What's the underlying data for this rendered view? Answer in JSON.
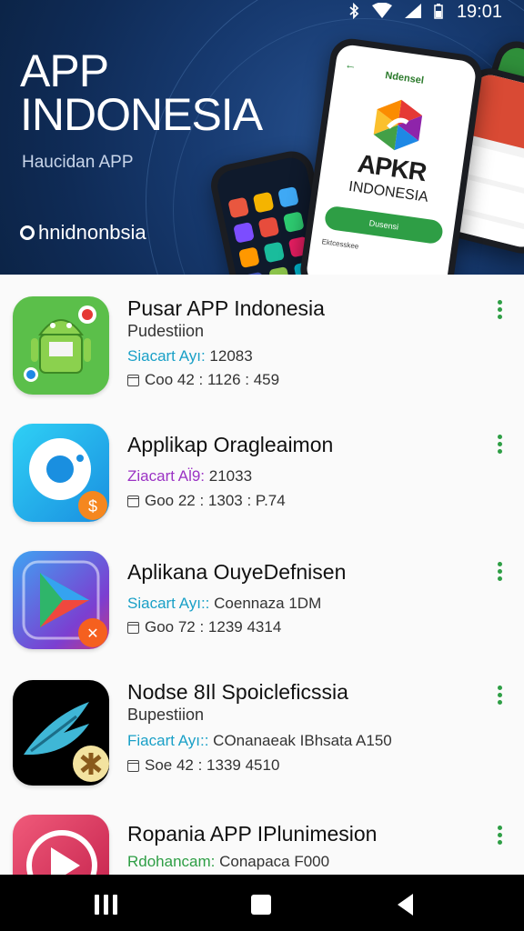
{
  "status_bar": {
    "time": "19:01"
  },
  "banner": {
    "title_line1": "APP",
    "title_line2": "INDONESIA",
    "subtitle": "Haucidan APP",
    "brand": "hnidnonbsia",
    "mockup": {
      "header": "Ndensel",
      "word": "APKR",
      "word2": "INDONESIA",
      "button": "Dusensi",
      "footer": "Ektcesskee"
    }
  },
  "apps": [
    {
      "title": "Pusar APP Indonesia",
      "subtitle": "Pudestiion",
      "meta1_key": "Siacart Ayı:",
      "meta1_val": " 12083",
      "meta2": "Coo 42 : 1126 : 459"
    },
    {
      "title": "Applikap Oraglеаimon",
      "subtitle": "",
      "meta1_key": "Ziacart Al̈9:",
      "meta1_val": " 21033",
      "meta2": "Goo 22 : 1303 : P.74"
    },
    {
      "title": "Aplikana OuyeDefnisen",
      "subtitle": "",
      "meta1_key": "Siacart Ayı::",
      "meta1_val": " Coennaza 1DM",
      "meta2": "Goo 72 : 1239 4314"
    },
    {
      "title": "Nodse 8Il Spoicleficssia",
      "subtitle": "Bupestiion",
      "meta1_key": "Fiacart Ayı::",
      "meta1_val": " COnanaeak IBhsata A150",
      "meta2": "Soe 42 : 1339 4510"
    },
    {
      "title": "Ropania APP IPlunimesion",
      "subtitle": "",
      "meta1_key": "Rdohancam:",
      "meta1_val": " Conapaca F000",
      "meta2": ""
    }
  ],
  "colors": {
    "accent": "#2e9e45",
    "banner_bg": "#0f2b56",
    "meta_key": "#1aa0c7"
  }
}
